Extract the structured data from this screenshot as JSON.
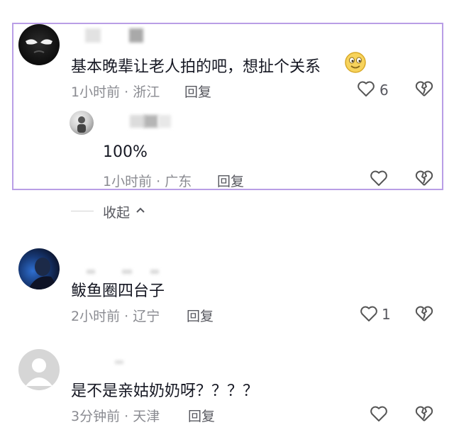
{
  "comments": [
    {
      "text": "基本晚辈让老人拍的吧，想扯个关系",
      "emoji": "smiling-emoji",
      "time": "1小时前",
      "location": "浙江",
      "reply_label": "回复",
      "likes": "6",
      "replies": [
        {
          "text": "100%",
          "time": "1小时前",
          "location": "广东",
          "reply_label": "回复"
        }
      ],
      "collapse_label": "收起"
    },
    {
      "text": "鲅鱼圈四台子",
      "time": "2小时前",
      "location": "辽宁",
      "reply_label": "回复",
      "likes": "1"
    },
    {
      "text": "是不是亲姑奶奶呀？？？？",
      "time": "3分钟前",
      "location": "天津",
      "reply_label": "回复"
    }
  ],
  "separator": "·",
  "colors": {
    "highlight_border": "#b99ee6",
    "text": "#161823",
    "meta": "#8a8b91"
  }
}
